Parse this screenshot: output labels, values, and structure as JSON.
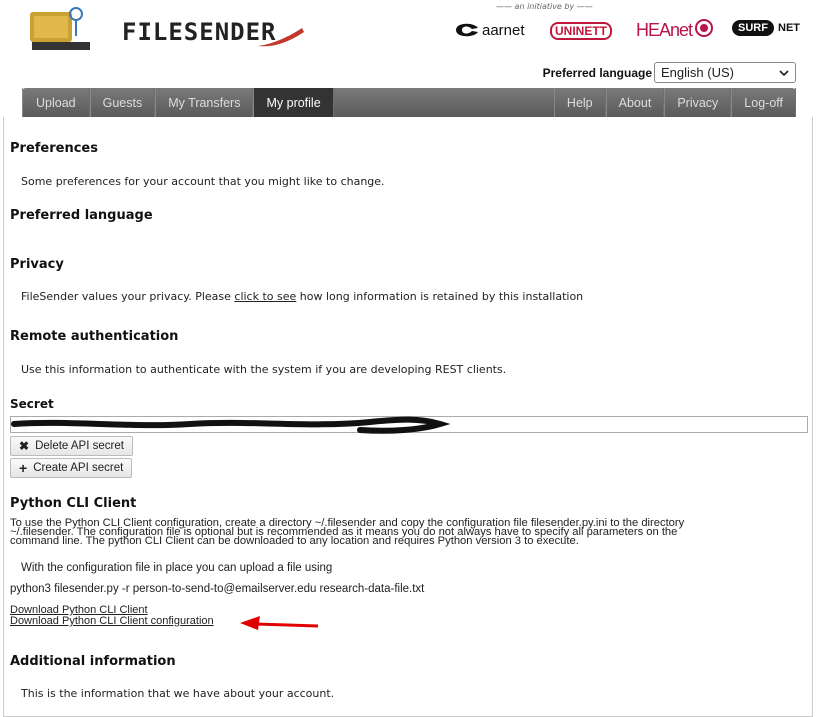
{
  "header": {
    "logo_text": "FILESENDER",
    "initiative": "an initiative by",
    "partners": [
      "aarnet",
      "UNINETT",
      "HEAnet",
      "SURF",
      "NET"
    ],
    "preferred_language_label": "Preferred language",
    "language_value": "English (US)"
  },
  "nav": {
    "left": [
      "Upload",
      "Guests",
      "My Transfers",
      "My profile"
    ],
    "right": [
      "Help",
      "About",
      "Privacy",
      "Log-off"
    ],
    "active": "My profile"
  },
  "sections": {
    "preferences_title": "Preferences",
    "preferences_text": "Some preferences for your account that you might like to change.",
    "preferred_language_title": "Preferred language",
    "privacy_title": "Privacy",
    "privacy_text_before": "FileSender values your privacy. Please ",
    "privacy_link": "click to see",
    "privacy_text_after": " how long information is retained by this installation",
    "remote_auth_title": "Remote authentication",
    "remote_auth_text": "Use this information to authenticate with the system if you are developing REST clients.",
    "secret_title": "Secret",
    "delete_api_button": "Delete API secret",
    "create_api_button": "Create API secret",
    "python_title": "Python CLI Client",
    "python_text_1": "To use the Python CLI Client configuration, create a directory ~/.filesender and copy the configuration file filesender.py.ini to the directory",
    "python_text_2": "~/.filesender. The configuration file is optional but is recommended as it means you do not always have to specify all parameters on the",
    "python_text_3": "command line. The python CLI Client can be downloaded to any location and requires Python version 3 to execute.",
    "python_upload_hint": "With the configuration file in place you can upload a file using",
    "python_command": "python3 filesender.py -r person-to-send-to@emailserver.edu research-data-file.txt",
    "download_client": "Download Python CLI Client",
    "download_config": "Download Python CLI Client configuration",
    "additional_title": "Additional information",
    "additional_text": "This is the information that we have about your account."
  },
  "colors": {
    "nav_bg": "#666666",
    "nav_active": "#333333",
    "arrow": "#e00000"
  }
}
